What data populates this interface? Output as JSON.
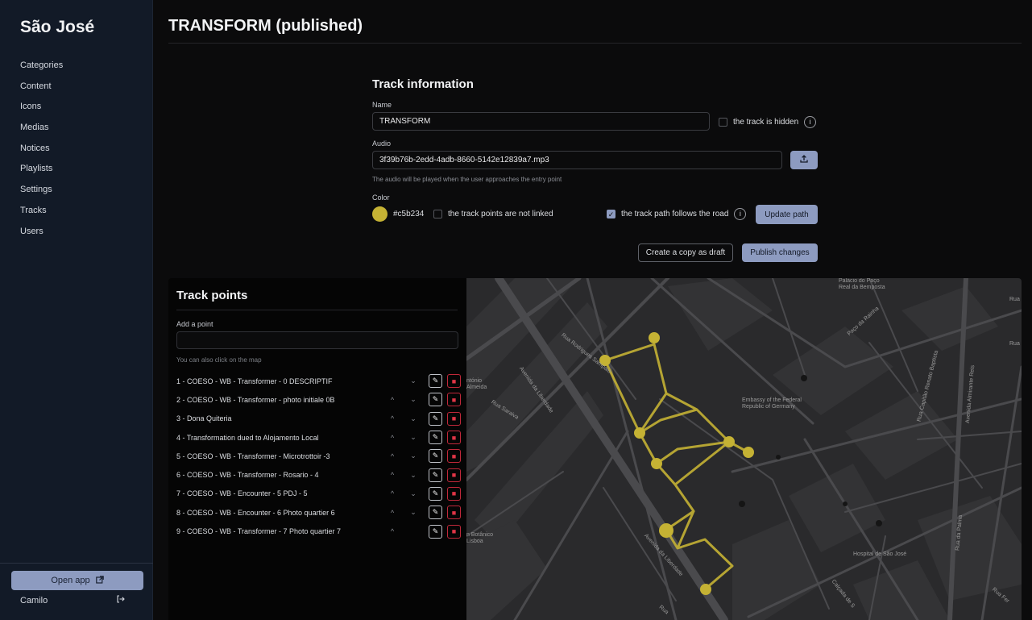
{
  "sidebar": {
    "brand": "São José",
    "items": [
      {
        "label": "Categories"
      },
      {
        "label": "Content"
      },
      {
        "label": "Icons"
      },
      {
        "label": "Medias"
      },
      {
        "label": "Notices"
      },
      {
        "label": "Playlists"
      },
      {
        "label": "Settings"
      },
      {
        "label": "Tracks"
      },
      {
        "label": "Users"
      }
    ],
    "open_app_label": "Open app",
    "user_name": "Camilo"
  },
  "header": {
    "title": "TRANSFORM (published)"
  },
  "form": {
    "title": "Track information",
    "name_label": "Name",
    "name_value": "TRANSFORM",
    "hidden_label": "the track is hidden",
    "audio_label": "Audio",
    "audio_value": "3f39b76b-2edd-4adb-8660-5142e12839a7.mp3",
    "audio_hint": "The audio will be played when the user approaches the entry point",
    "color_label": "Color",
    "color_value": "#c5b234",
    "not_linked_label": "the track points are not linked",
    "follows_road_label": "the track path follows the road",
    "update_path_label": "Update path",
    "copy_draft_label": "Create a copy as draft",
    "publish_label": "Publish changes"
  },
  "track_points": {
    "title": "Track points",
    "add_label": "Add a point",
    "hint": "You can also click on the map",
    "items": [
      {
        "label": "1 - COESO - WB - Transformer - 0 DESCRIPTIF"
      },
      {
        "label": "2 - COESO - WB - Transformer - photo initiale 0B"
      },
      {
        "label": "3 - Dona Quiteria"
      },
      {
        "label": "4 - Transformation dued to Alojamento Local"
      },
      {
        "label": "5 - COESO - WB - Transformer - Microtrottoir -3"
      },
      {
        "label": "6 - COESO - WB - Transformer - Rosario - 4"
      },
      {
        "label": "7 - COESO - WB - Encounter - 5 PDJ - 5"
      },
      {
        "label": "8 - COESO - WB - Encounter - 6 Photo quartier 6"
      },
      {
        "label": "9 - COESO - WB - Transformer - 7 Photo quartier 7"
      }
    ]
  },
  "map": {
    "labels": {
      "palace": "Palácio do Paço\nReal da Bemposta",
      "embassy": "Embassy of the Federal\nRepublic of Germany",
      "hospital": "Hospital de São José",
      "botanico": "n Botânico\nLisboa",
      "antonio": "ntónio\nAlmeida",
      "rua_top_right": "Rua",
      "rua_right": "Rua",
      "rua_rodrigues": "Rua Rodrigues Sampaio",
      "av_liberdade_top": "Avenida da Liberdade",
      "av_liberdade_bottom": "Avenida da Liberdade",
      "saraiva": "Rua Saraiva",
      "paco_rainha": "Paço da Rainha",
      "capitao": "Rua Capitão Renato Baptista",
      "almirante": "Avenida Almirante Reis",
      "palma": "Rua da Palma",
      "calcada": "Calçada de S",
      "rua_bottom": "Rua",
      "rua_fer": "Rua Fer"
    }
  },
  "colors": {
    "accent": "#8d9bc0",
    "track": "#c5b234",
    "danger": "#e03546"
  }
}
